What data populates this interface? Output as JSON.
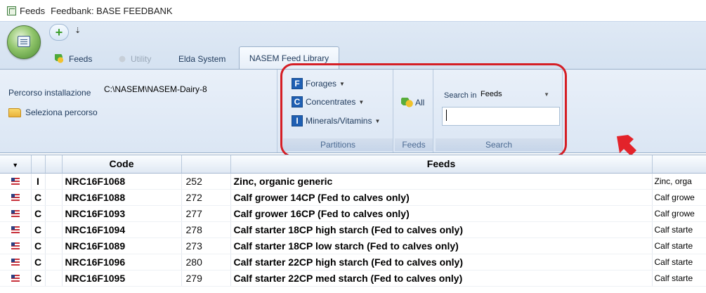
{
  "window": {
    "title_app": "Feeds",
    "title_feedbank": "Feedbank: BASE FEEDBANK"
  },
  "quick_access": {
    "add_glyph": "+",
    "customize_glyph": "⇣"
  },
  "tabs": [
    {
      "label": "Feeds"
    },
    {
      "label": "Utility"
    },
    {
      "label": "Elda System"
    },
    {
      "label": "NASEM Feed Library"
    }
  ],
  "ribbon": {
    "path_group": {
      "path_label": "Percorso installazione",
      "path_value": "C:\\NASEM\\NASEM-Dairy-8",
      "select_path_label": "Seleziona percorso"
    },
    "partitions": {
      "group_label": "Partitions",
      "items": [
        {
          "letter": "F",
          "label": "Forages"
        },
        {
          "letter": "C",
          "label": "Concentrates"
        },
        {
          "letter": "I",
          "label": "Minerals/Vitamins"
        }
      ]
    },
    "feeds_group": {
      "group_label": "Feeds",
      "all_label": "All"
    },
    "search_group": {
      "group_label": "Search",
      "search_in_label": "Search in",
      "search_in_value": "Feeds",
      "search_value": ""
    }
  },
  "grid": {
    "headers": {
      "code": "Code",
      "feeds": "Feeds"
    },
    "rows": [
      {
        "type": "I",
        "code": "NRC16F1068",
        "num": "252",
        "name": "Zinc, organic generic",
        "extra": "Zinc, orga"
      },
      {
        "type": "C",
        "code": "NRC16F1088",
        "num": "272",
        "name": "Calf grower 14CP (Fed to calves only)",
        "extra": "Calf growe"
      },
      {
        "type": "C",
        "code": "NRC16F1093",
        "num": "277",
        "name": "Calf grower 16CP (Fed to calves only)",
        "extra": "Calf growe"
      },
      {
        "type": "C",
        "code": "NRC16F1094",
        "num": "278",
        "name": "Calf starter 18CP high starch (Fed to calves only)",
        "extra": "Calf starte"
      },
      {
        "type": "C",
        "code": "NRC16F1089",
        "num": "273",
        "name": "Calf starter 18CP low starch (Fed to calves only)",
        "extra": "Calf starte"
      },
      {
        "type": "C",
        "code": "NRC16F1096",
        "num": "280",
        "name": "Calf starter 22CP high starch (Fed to calves only)",
        "extra": "Calf starte"
      },
      {
        "type": "C",
        "code": "NRC16F1095",
        "num": "279",
        "name": "Calf starter 22CP med starch (Fed to calves only)",
        "extra": "Calf starte"
      }
    ]
  },
  "colors": {
    "highlight_frame": "#d51e25",
    "ribbon_bg": "#dbe6f4",
    "partition_icon": "#1f5fb3"
  }
}
